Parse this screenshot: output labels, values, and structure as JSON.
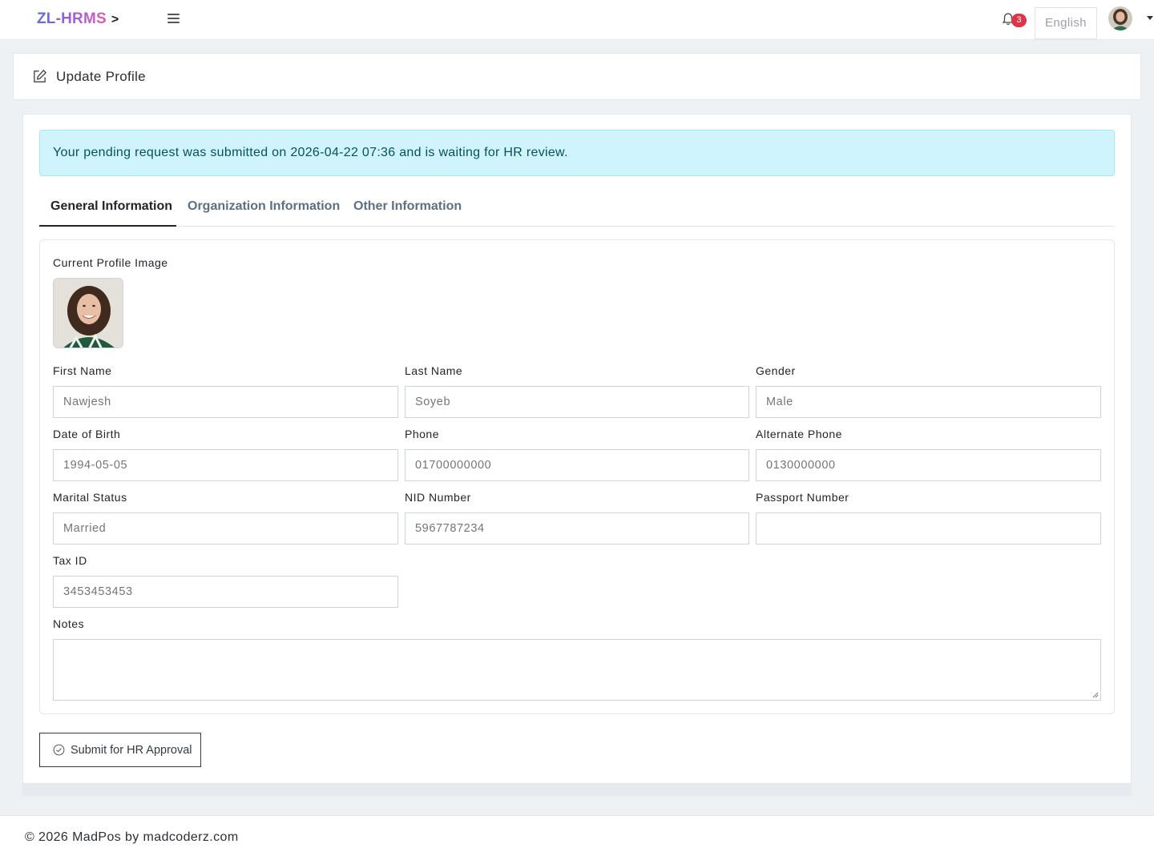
{
  "topbar": {
    "brand": "ZL-HRMS",
    "brand_suffix": ">",
    "notification_count": "3",
    "language": "English"
  },
  "page_header": {
    "title": "Update Profile"
  },
  "alert": {
    "message": "Your pending request was submitted on 2026-04-22 07:36 and is waiting for HR review."
  },
  "tabs": [
    {
      "label": "General Information",
      "active": true
    },
    {
      "label": "Organization Information",
      "active": false
    },
    {
      "label": "Other Information",
      "active": false
    }
  ],
  "form": {
    "profile_image_label": "Current Profile Image",
    "fields": {
      "first_name": {
        "label": "First Name",
        "placeholder": "Nawjesh"
      },
      "last_name": {
        "label": "Last Name",
        "placeholder": "Soyeb"
      },
      "gender": {
        "label": "Gender",
        "placeholder": "Male"
      },
      "dob": {
        "label": "Date of Birth",
        "placeholder": "1994-05-05"
      },
      "phone": {
        "label": "Phone",
        "placeholder": "01700000000"
      },
      "alt_phone": {
        "label": "Alternate Phone",
        "placeholder": "0130000000"
      },
      "marital_status": {
        "label": "Marital Status",
        "placeholder": "Married"
      },
      "nid": {
        "label": "NID Number",
        "placeholder": "5967787234"
      },
      "passport": {
        "label": "Passport Number",
        "placeholder": ""
      },
      "tax_id": {
        "label": "Tax ID",
        "placeholder": "3453453453"
      },
      "notes": {
        "label": "Notes",
        "placeholder": ""
      }
    },
    "submit_label": "Submit for HR Approval"
  },
  "footer": {
    "copyright": "© 2026 MadPos by madcoderz.com"
  },
  "colors": {
    "alert_bg": "#cff4fc",
    "alert_text": "#055160",
    "badge": "#dc3545",
    "brand_gradient_start": "#5b6ee1",
    "brand_gradient_end": "#e05ab6"
  }
}
